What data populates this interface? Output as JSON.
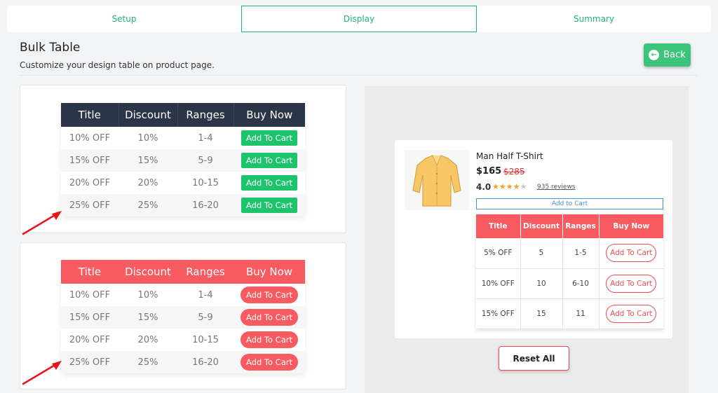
{
  "tabs": [
    {
      "label": "Setup"
    },
    {
      "label": "Display"
    },
    {
      "label": "Summary"
    }
  ],
  "header": {
    "title": "Bulk Table",
    "subtitle": "Customize your design table on product page.",
    "back_label": "Back"
  },
  "table_dark": {
    "headers": [
      "Title",
      "Discount",
      "Ranges",
      "Buy Now"
    ],
    "rows": [
      {
        "title": "10% OFF",
        "discount": "10%",
        "range": "1-4",
        "button": "Add To Cart"
      },
      {
        "title": "15% OFF",
        "discount": "15%",
        "range": "5-9",
        "button": "Add To Cart"
      },
      {
        "title": "20% OFF",
        "discount": "20%",
        "range": "10-15",
        "button": "Add To Cart"
      },
      {
        "title": "25% OFF",
        "discount": "25%",
        "range": "16-20",
        "button": "Add To Cart"
      }
    ]
  },
  "table_red": {
    "headers": [
      "Title",
      "Discount",
      "Ranges",
      "Buy Now"
    ],
    "rows": [
      {
        "title": "10% OFF",
        "discount": "10%",
        "range": "1-4",
        "button": "Add To Cart"
      },
      {
        "title": "15% OFF",
        "discount": "15%",
        "range": "5-9",
        "button": "Add To Cart"
      },
      {
        "title": "20% OFF",
        "discount": "20%",
        "range": "10-15",
        "button": "Add To Cart"
      },
      {
        "title": "25% OFF",
        "discount": "25%",
        "range": "16-20",
        "button": "Add To Cart"
      }
    ]
  },
  "preview": {
    "product_name": "Man Half T-Shirt",
    "price": "$165",
    "old_price": "$285",
    "rating": "4.0",
    "stars_filled": 4,
    "stars_total": 5,
    "reviews": "935 reviews",
    "add_to_cart": "Add to Cart",
    "table": {
      "headers": [
        "Title",
        "Discount",
        "Ranges",
        "Buy Now"
      ],
      "rows": [
        {
          "title": "5% OFF",
          "discount": "5",
          "range": "1-5",
          "button": "Add To Cart"
        },
        {
          "title": "10% OFF",
          "discount": "10",
          "range": "6-10",
          "button": "Add To Cart"
        },
        {
          "title": "15% OFF",
          "discount": "15",
          "range": "11",
          "button": "Add To Cart"
        }
      ]
    }
  },
  "reset_label": "Reset All",
  "colors": {
    "accent_green": "#22b573",
    "dark_header": "#2c3447",
    "red_header": "#f75a5f",
    "arrow_red": "#e8151b"
  }
}
